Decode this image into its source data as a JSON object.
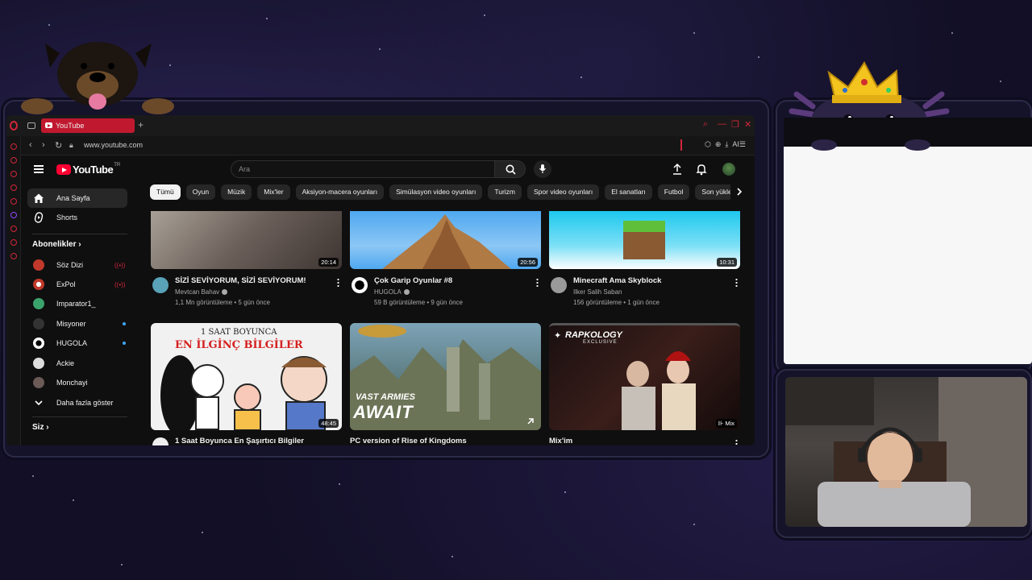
{
  "browser": {
    "tab_title": "YouTube",
    "url": "www.youtube.com",
    "ai_label": "AI"
  },
  "youtube": {
    "logo_text": "YouTube",
    "logo_region": "TR",
    "search_placeholder": "Ara",
    "sidebar": {
      "home": "Ana Sayfa",
      "shorts": "Shorts",
      "subscriptions_header": "Abonelikler",
      "channels": [
        "Söz Dizi",
        "ExPol",
        "Imparator1_",
        "Misyoner",
        "HUGOLA",
        "Ackie",
        "Monchayi"
      ],
      "show_more": "Daha fazla göster",
      "you_header": "Siz"
    },
    "chips": [
      "Tümü",
      "Oyun",
      "Müzik",
      "Mix'ler",
      "Aksiyon-macera oyunları",
      "Simülasyon video oyunları",
      "Turizm",
      "Spor video oyunları",
      "El sanatları",
      "Futbol",
      "Son yükle"
    ],
    "videos": [
      {
        "title": "SİZİ SEVİYORUM, SİZİ SEVİYORUM!",
        "channel": "Mevtcan Bahav",
        "views": "1,1 Mn görüntüleme",
        "age": "5 gün önce",
        "duration": "20:14"
      },
      {
        "title": "Çok Garip Oyunlar #8",
        "channel": "HUGOLA",
        "views": "59 B görüntüleme",
        "age": "9 gün önce",
        "duration": "20:56"
      },
      {
        "title": "Minecraft Ama Skyblock",
        "channel": "Ilker Salih Saban",
        "views": "156 görüntüleme",
        "age": "1 gün önce",
        "duration": "10:31"
      },
      {
        "title": "1 Saat Boyunca En Şaşırtıcı Bilgiler",
        "duration": "48:45",
        "thumb_line1": "1 SAAT BOYUNCA",
        "thumb_line2": "EN İLGİNÇ BİLGİLER"
      },
      {
        "title": "PC version of Rise of Kingdoms",
        "thumb_line1": "VAST ARMIES",
        "thumb_line2": "AWAIT"
      },
      {
        "title": "Mix'im",
        "badge": "Mix",
        "thumb_line1": "RAPKOLOGY",
        "thumb_line2": "EXCLUSIVE"
      }
    ]
  }
}
